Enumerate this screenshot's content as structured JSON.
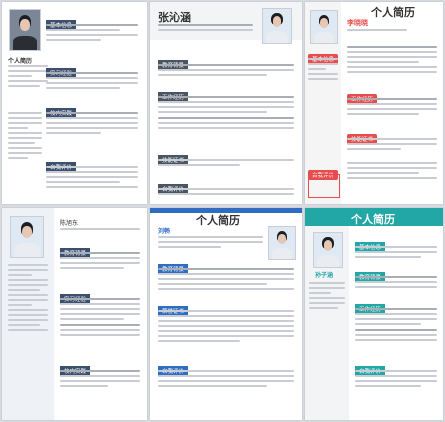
{
  "tiles": {
    "t1": {
      "title": "个人简历",
      "sections": [
        "基本信息",
        "实习经验",
        "校内实践",
        "自我评价"
      ],
      "accent": "#3b4f6e"
    },
    "t2": {
      "name": "张沁涵",
      "sections": [
        "教育背景",
        "工作经历",
        "技能证书",
        "自我评价"
      ],
      "accent": "#4a5563"
    },
    "t3": {
      "title": "个人简历",
      "name": "李晓晓",
      "sections": [
        "基本信息",
        "工作经历",
        "技能证书",
        "自我评价"
      ],
      "accent": "#e94c4c"
    },
    "t4": {
      "name": "陈旭东",
      "sections": [
        "教育背景",
        "实习经验",
        "校内实践"
      ],
      "accent": "#3b4f6e"
    },
    "t5": {
      "title": "个人简历",
      "name": "刘畅",
      "sections": [
        "教育背景",
        "荣誉证书",
        "自我评价"
      ],
      "accent": "#2f6dc2"
    },
    "t6": {
      "title": "个人简历",
      "name": "孙子涵",
      "sections": [
        "基本信息",
        "教育背景",
        "工作经历",
        "自我评价"
      ],
      "accent": "#22a6a6"
    }
  }
}
